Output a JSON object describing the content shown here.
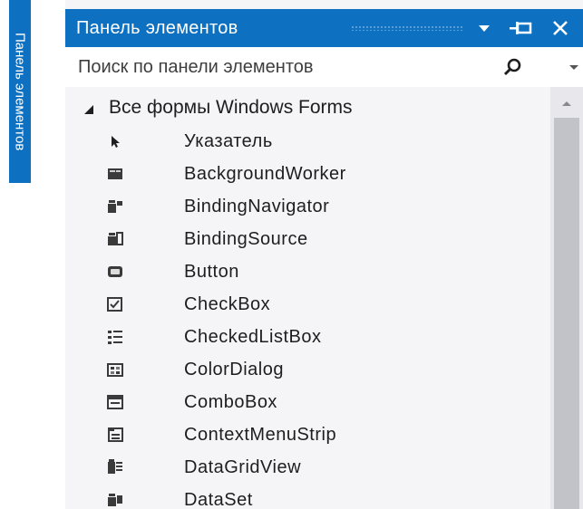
{
  "side_tab": {
    "label": "Панель элементов"
  },
  "panel": {
    "title": "Панель элементов",
    "search_placeholder": "Поиск по панели элементов",
    "group": {
      "label": "Все формы Windows Forms",
      "expanded": true
    },
    "items": [
      {
        "label": "Указатель",
        "icon": "pointer-icon"
      },
      {
        "label": "BackgroundWorker",
        "icon": "background-worker-icon"
      },
      {
        "label": "BindingNavigator",
        "icon": "binding-navigator-icon"
      },
      {
        "label": "BindingSource",
        "icon": "binding-source-icon"
      },
      {
        "label": "Button",
        "icon": "button-icon"
      },
      {
        "label": "CheckBox",
        "icon": "checkbox-icon"
      },
      {
        "label": "CheckedListBox",
        "icon": "checked-list-box-icon"
      },
      {
        "label": "ColorDialog",
        "icon": "color-dialog-icon"
      },
      {
        "label": "ComboBox",
        "icon": "combobox-icon"
      },
      {
        "label": "ContextMenuStrip",
        "icon": "context-menu-strip-icon"
      },
      {
        "label": "DataGridView",
        "icon": "data-grid-view-icon"
      },
      {
        "label": "DataSet",
        "icon": "dataset-icon"
      }
    ]
  },
  "colors": {
    "accent": "#0e70c0",
    "background": "#f5f5f7",
    "text": "#1e1e1e",
    "scroll_thumb": "#c2c3c9"
  }
}
